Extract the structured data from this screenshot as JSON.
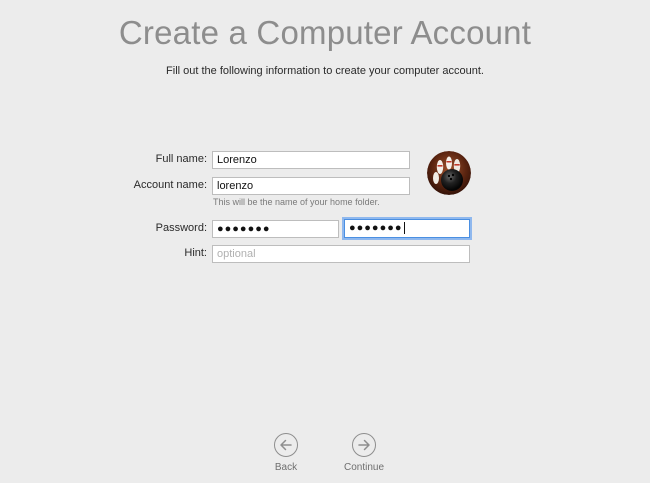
{
  "header": {
    "title": "Create a Computer Account",
    "subtitle": "Fill out the following information to create your computer account."
  },
  "form": {
    "full_name": {
      "label": "Full name:",
      "value": "Lorenzo"
    },
    "account_name": {
      "label": "Account name:",
      "value": "lorenzo",
      "help": "This will be the name of your home folder."
    },
    "password": {
      "label": "Password:",
      "masked": "●●●●●●●",
      "verify_masked": "●●●●●●●"
    },
    "hint": {
      "label": "Hint:",
      "placeholder": "optional",
      "value": ""
    }
  },
  "avatar": {
    "icon": "bowling-ball-and-pins-icon"
  },
  "nav": {
    "back_label": "Back",
    "continue_label": "Continue"
  },
  "colors": {
    "background": "#ececec",
    "title": "#8d8d8d",
    "focus_ring": "#4a8fe2"
  }
}
